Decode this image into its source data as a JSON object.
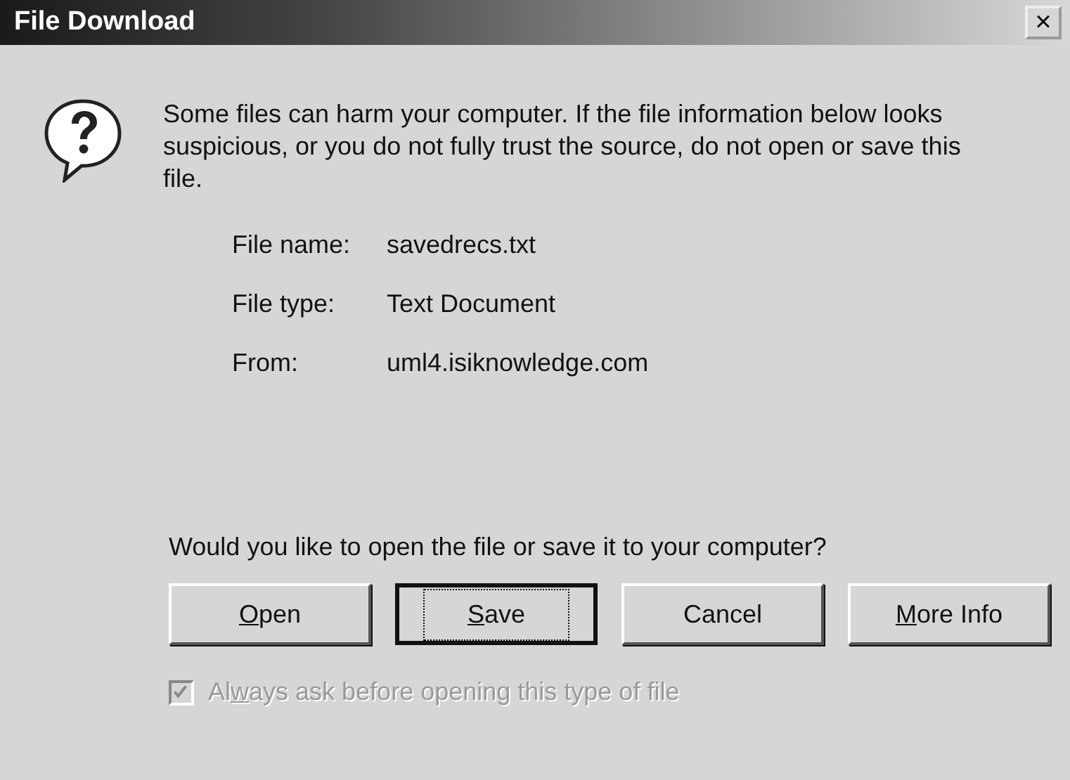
{
  "window": {
    "title": "File Download",
    "close_glyph": "×"
  },
  "warning": "Some files can harm your computer. If the file information below looks suspicious, or you do not fully trust the source, do not open or save this file.",
  "file_info": [
    {
      "label": "File name:",
      "value": "savedrecs.txt"
    },
    {
      "label": "File type:",
      "value": "Text Document"
    },
    {
      "label": "From:",
      "value": "uml4.isiknowledge.com"
    }
  ],
  "question": "Would you like to open the file or save it to your computer?",
  "buttons": [
    {
      "key": "O",
      "after": "pen",
      "default": false
    },
    {
      "key": "S",
      "after": "ave",
      "default": true
    },
    {
      "before": "Cancel",
      "default": false
    },
    {
      "key": "M",
      "after": "ore Info",
      "default": false
    }
  ],
  "checkbox": {
    "before": "Al",
    "key": "w",
    "after": "ays ask before opening this type of file",
    "checked": true,
    "disabled": true
  }
}
